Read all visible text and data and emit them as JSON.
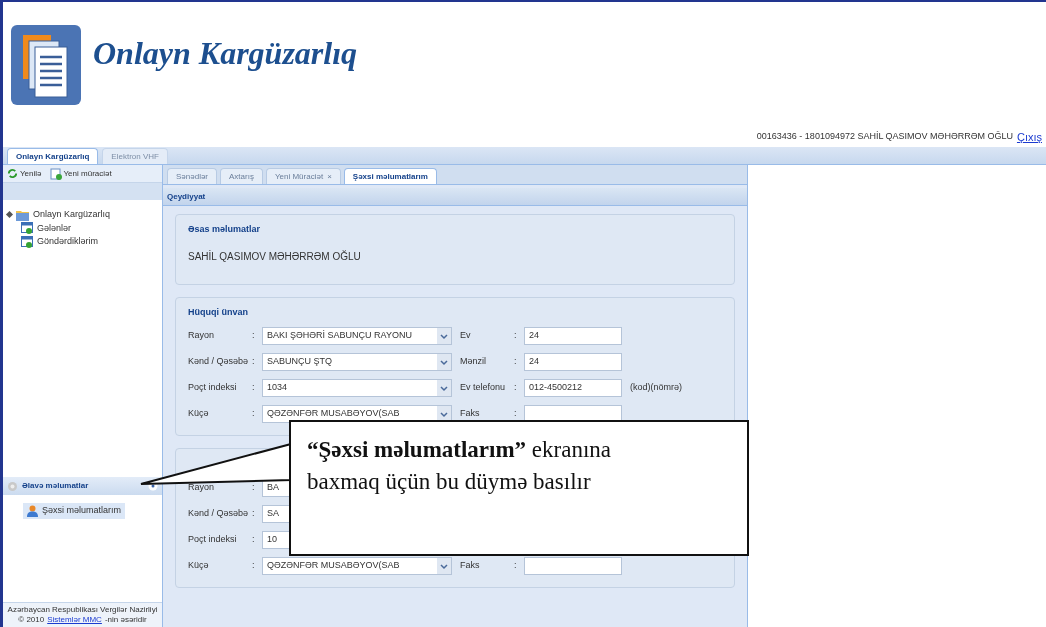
{
  "header": {
    "title": "Onlayn Kargüzarlıq",
    "user": "00163436 - 1801094972 SAHİL QASIMOV MƏHƏRRƏM OĞLU",
    "logout": "Çıxış"
  },
  "app_tabs": [
    {
      "label": "Onlayn Kargüzarlıq",
      "selected": true
    },
    {
      "label": "Elektron VHF",
      "selected": false
    }
  ],
  "toolbar": [
    {
      "label": "Yenilə",
      "kind": "refresh"
    },
    {
      "label": "Yeni müraciət",
      "kind": "new"
    }
  ],
  "tree": [
    {
      "label": "Onlayn Kargüzarlıq",
      "expanded": true,
      "children": [
        {
          "label": "Gələnlər"
        },
        {
          "label": "Göndərdiklərim"
        }
      ]
    }
  ],
  "accordion": {
    "title": "Əlavə məlumatlar",
    "items": [
      {
        "label": "Şəxsi məlumatlarım",
        "selected": true
      }
    ]
  },
  "footer": {
    "line1": "Azərbaycan Respublikası Vergilər Nazirliyi",
    "prefix": "© 2010",
    "link": "Sistemlər MMC",
    "suffix": "-nin əsəridir"
  },
  "main_tabs": [
    {
      "label": "Sənədlər",
      "selected": false
    },
    {
      "label": "Axtarış",
      "selected": false
    },
    {
      "label": "Yeni Müraciət",
      "close": "×",
      "selected": false
    },
    {
      "label": "Şəxsi məlumatlarım",
      "selected": true
    }
  ],
  "panel_title": "Qeydiyyat",
  "fieldsets": [
    {
      "legend": "Əsas məlumatlar",
      "kind": "text",
      "text": "SAHİL QASIMOV MƏHƏRRƏM OĞLU"
    },
    {
      "legend": "Hüquqi ünvan",
      "kind": "address",
      "rows": [
        {
          "label": "Rayon",
          "sep": ":",
          "value": "BAKI ŞƏHƏRİ SABUNÇU RAYONU",
          "dropdown": true,
          "right_label": "Ev",
          "right_sep": ":",
          "right_value": "24"
        },
        {
          "label": "Kənd / Qəsəbə",
          "sep": ":",
          "value": "SABUNÇU ŞTQ",
          "dropdown": true,
          "right_label": "Mənzil",
          "right_sep": ":",
          "right_value": "24"
        },
        {
          "label": "Poçt indeksi",
          "sep": ":",
          "value": "1034",
          "dropdown": true,
          "right_label": "Ev telefonu",
          "right_sep": ":",
          "right_value": "012-4500212",
          "note": "(kod)(nömrə)"
        },
        {
          "label": "Küçə",
          "sep": ":",
          "value": "QƏZƏNFƏR MUSABƏYOV(SAB",
          "dropdown": true,
          "right_label": "Faks",
          "right_sep": ":"
        }
      ]
    },
    {
      "kind": "address",
      "rows": [
        {
          "label": "Rayon",
          "sep": ":",
          "value": "BA"
        },
        {
          "label": "Kənd / Qəsəbə",
          "sep": ":",
          "value": "SA"
        },
        {
          "label": "Poçt indeksi",
          "sep": ":",
          "value": "10"
        },
        {
          "label": "Küçə",
          "sep": ":",
          "value": "QƏZƏNFƏR MUSABƏYOV(SAB",
          "dropdown": true,
          "right_label": "Faks",
          "right_sep": ":"
        }
      ]
    }
  ],
  "callout": {
    "text": "**“Şəxsi məlumatlarım”** ekranına baxmaq üçün bu düymə basılır"
  }
}
